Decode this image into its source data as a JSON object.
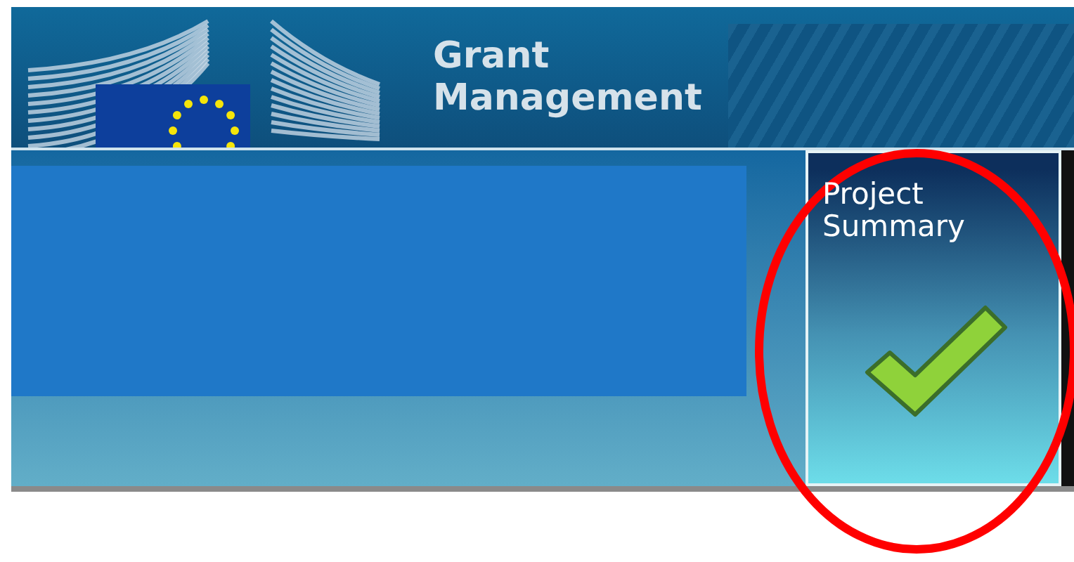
{
  "header": {
    "title": "Grant Management"
  },
  "tile": {
    "label": "Project Summary",
    "completed": true,
    "highlighted": true
  }
}
